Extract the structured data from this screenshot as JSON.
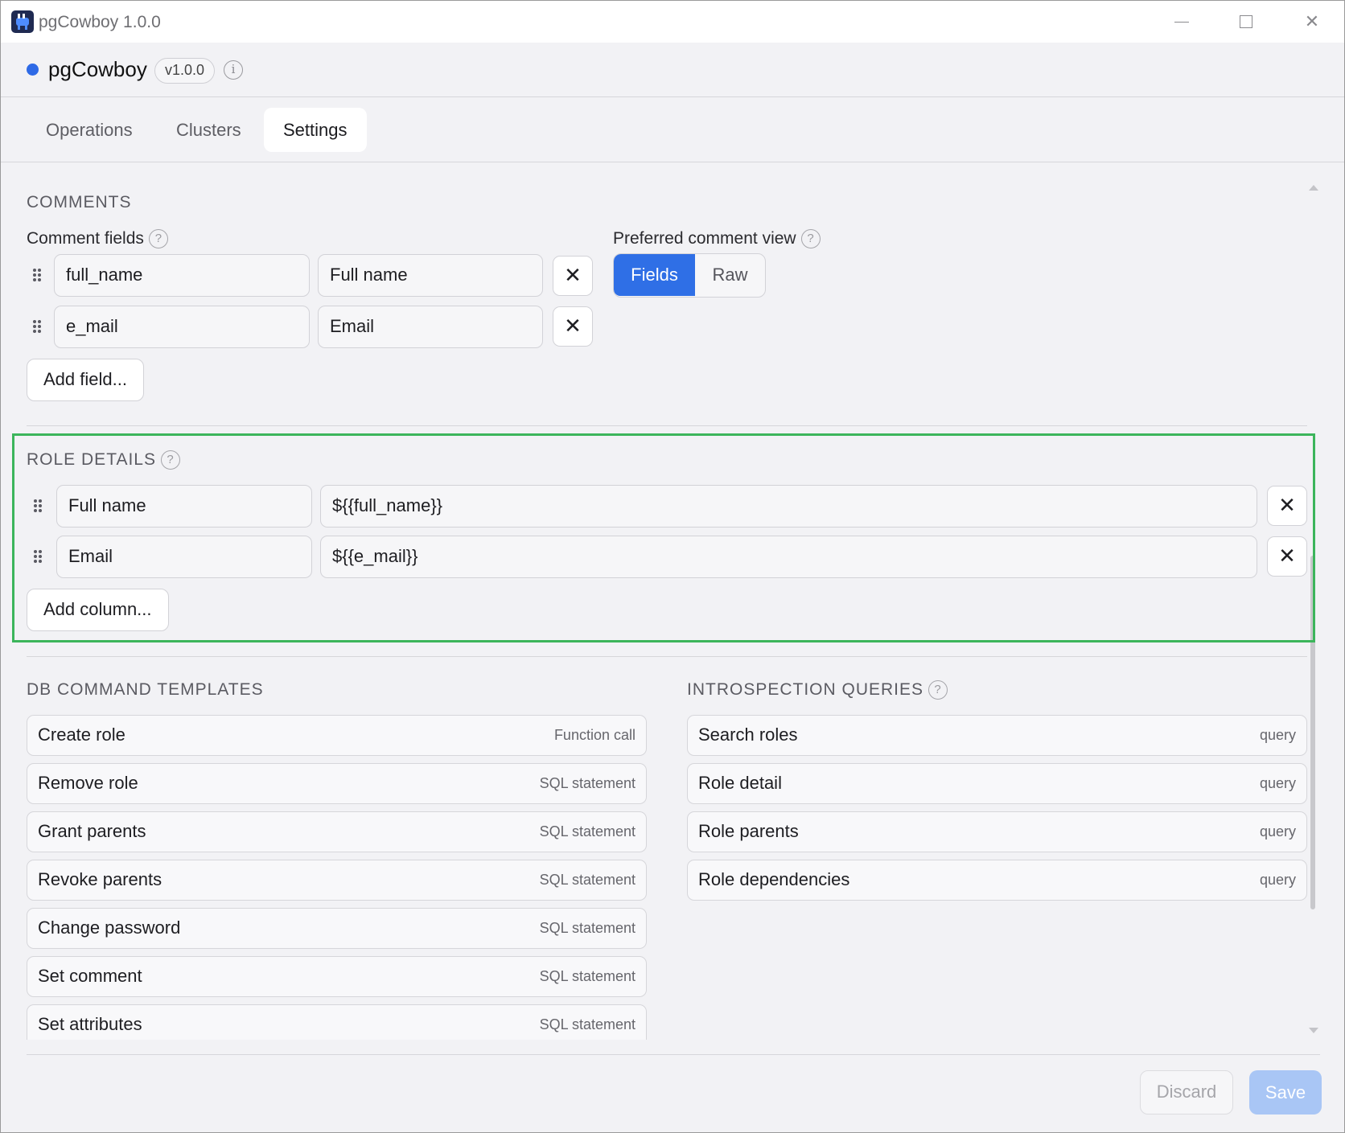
{
  "window": {
    "title": "pgCowboy 1.0.0",
    "icons": {
      "minimize": "minimize-icon",
      "maximize": "maximize-icon",
      "close": "close-icon"
    }
  },
  "header": {
    "app_name": "pgCowboy",
    "version": "v1.0.0",
    "status_color": "#2e6ae6",
    "info_glyph": "i"
  },
  "tabs": [
    {
      "label": "Operations",
      "active": false
    },
    {
      "label": "Clusters",
      "active": false
    },
    {
      "label": "Settings",
      "active": true
    }
  ],
  "comments": {
    "section_title": "COMMENTS",
    "fields_label": "Comment fields",
    "help_glyph": "?",
    "fields": [
      {
        "key": "full_name",
        "label": "Full name"
      },
      {
        "key": "e_mail",
        "label": "Email"
      }
    ],
    "remove_glyph": "✕",
    "add_button": "Add field...",
    "preferred_view_label": "Preferred comment view",
    "view_options": [
      "Fields",
      "Raw"
    ],
    "selected_view": "Fields"
  },
  "role_details": {
    "section_title": "ROLE DETAILS",
    "columns": [
      {
        "name": "Full name",
        "template": "${{full_name}}"
      },
      {
        "name": "Email",
        "template": "${{e_mail}}"
      }
    ],
    "add_button": "Add column..."
  },
  "db_command_templates": {
    "section_title": "DB COMMAND TEMPLATES",
    "items": [
      {
        "name": "Create role",
        "type": "Function call"
      },
      {
        "name": "Remove role",
        "type": "SQL statement"
      },
      {
        "name": "Grant parents",
        "type": "SQL statement"
      },
      {
        "name": "Revoke parents",
        "type": "SQL statement"
      },
      {
        "name": "Change password",
        "type": "SQL statement"
      },
      {
        "name": "Set comment",
        "type": "SQL statement"
      },
      {
        "name": "Set attributes",
        "type": "SQL statement"
      }
    ]
  },
  "introspection_queries": {
    "section_title": "INTROSPECTION QUERIES",
    "items": [
      {
        "name": "Search roles",
        "type": "query"
      },
      {
        "name": "Role detail",
        "type": "query"
      },
      {
        "name": "Role parents",
        "type": "query"
      },
      {
        "name": "Role dependencies",
        "type": "query"
      }
    ]
  },
  "footer": {
    "discard_label": "Discard",
    "save_label": "Save"
  },
  "colors": {
    "accent": "#2f6fe6",
    "highlight": "#3cb55b",
    "save_disabled": "#a9c6f5"
  }
}
